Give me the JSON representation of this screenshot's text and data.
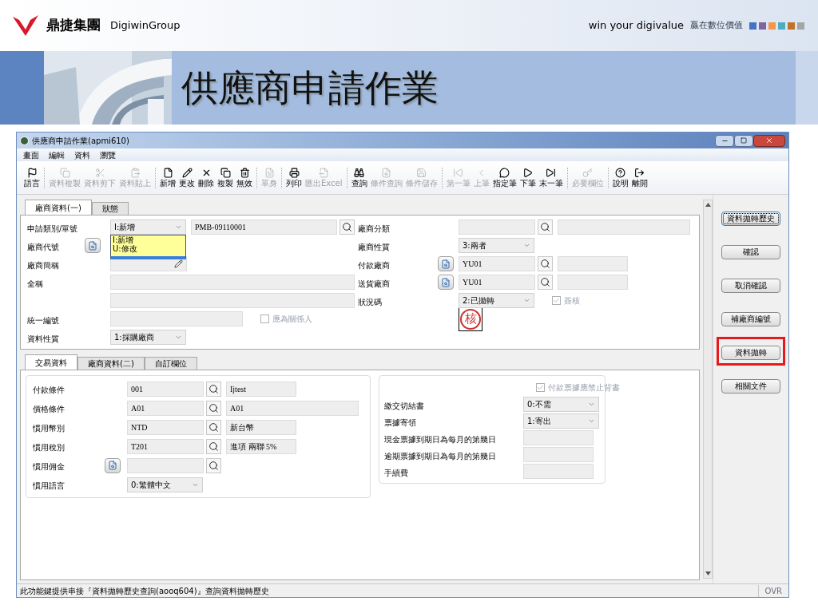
{
  "slide": {
    "brand": "鼎捷集團",
    "brand_en": "DigiwinGroup",
    "slogan": "win your digivalue",
    "slogan_zh": "贏在數位價值",
    "title": "供應商申請作業"
  },
  "window": {
    "title": "供應商申請作業(apmi610)",
    "menu": [
      "畫面",
      "編輯",
      "資料",
      "瀏覽"
    ],
    "toolbar": [
      [
        {
          "label": "語言",
          "disabled": false
        }
      ],
      [
        {
          "label": "資料複製",
          "disabled": true
        },
        {
          "label": "資料剪下",
          "disabled": true
        },
        {
          "label": "資料貼上",
          "disabled": true
        }
      ],
      [
        {
          "label": "新增",
          "disabled": false
        },
        {
          "label": "更改",
          "disabled": false
        },
        {
          "label": "刪除",
          "disabled": false
        },
        {
          "label": "複製",
          "disabled": false
        },
        {
          "label": "無效",
          "disabled": false
        }
      ],
      [
        {
          "label": "單身",
          "disabled": true
        }
      ],
      [
        {
          "label": "列印",
          "disabled": false
        },
        {
          "label": "匯出Excel",
          "disabled": true
        }
      ],
      [
        {
          "label": "查詢",
          "disabled": false
        },
        {
          "label": "條件查詢",
          "disabled": true
        },
        {
          "label": "條件儲存",
          "disabled": true
        }
      ],
      [
        {
          "label": "第一筆",
          "disabled": true
        },
        {
          "label": "上筆",
          "disabled": true
        },
        {
          "label": "指定筆",
          "disabled": false
        },
        {
          "label": "下筆",
          "disabled": false
        },
        {
          "label": "末一筆",
          "disabled": false
        }
      ],
      [
        {
          "label": "必要欄位",
          "disabled": true
        }
      ],
      [
        {
          "label": "說明",
          "disabled": false
        },
        {
          "label": "離開",
          "disabled": false
        }
      ]
    ],
    "tabs": [
      {
        "label": "廠商資料(一)",
        "selected": true
      },
      {
        "label": "狀態",
        "selected": false
      }
    ],
    "form_left": [
      {
        "label": "申請類別/單號",
        "controls": [
          {
            "kind": "select",
            "value": "I:新增",
            "open": true,
            "options": [
              "I:新增",
              "U:修改"
            ]
          },
          {
            "kind": "long_lookup",
            "value": "PMB-09110001"
          }
        ]
      },
      {
        "label": "廠商代號",
        "controls": [
          {
            "kind": "browse"
          }
        ]
      },
      {
        "label": "廠商簡稱",
        "controls": [
          {
            "kind": "edit"
          }
        ]
      },
      {
        "label": "全稱",
        "controls": [
          {
            "kind": "wide_field"
          }
        ]
      },
      {
        "controls": [
          {
            "kind": "wide_field"
          }
        ]
      },
      {
        "label": "統一編號",
        "controls": [
          {
            "kind": "long_field"
          },
          {
            "kind": "check",
            "label": "應為關係人",
            "checked": false,
            "disabled": true
          }
        ]
      },
      {
        "label": "資料性質",
        "controls": [
          {
            "kind": "select",
            "value": "1:採購廠商",
            "open": false
          }
        ]
      }
    ],
    "form_right": [
      {
        "label": "廠商分類",
        "controls": [
          {
            "kind": "lookup"
          },
          {
            "kind": "long_field"
          }
        ]
      },
      {
        "label": "廠商性質",
        "controls": [
          {
            "kind": "select",
            "value": "3:兩者",
            "open": false
          }
        ]
      },
      {
        "label": "付款廠商",
        "controls": [
          {
            "kind": "browse"
          },
          {
            "kind": "lookup",
            "value": "YU01"
          },
          {
            "kind": "field"
          }
        ]
      },
      {
        "label": "送貨廠商",
        "controls": [
          {
            "kind": "browse"
          },
          {
            "kind": "lookup",
            "value": "YU01"
          },
          {
            "kind": "field"
          }
        ]
      },
      {
        "label": "狀況碼",
        "controls": [
          {
            "kind": "select",
            "value": "2:已拋轉",
            "open": false
          },
          {
            "kind": "check",
            "label": "簽核",
            "checked": true,
            "disabled": true
          }
        ]
      },
      {
        "controls": [
          {
            "kind": "stamp",
            "value": "核"
          }
        ]
      }
    ],
    "side_buttons": [
      {
        "label": "資料拋轉歷史",
        "focused": true,
        "highlighted": false
      },
      {
        "label": "確認",
        "focused": false,
        "highlighted": false
      },
      {
        "label": "取消確認",
        "focused": false,
        "highlighted": false
      },
      {
        "label": "補廠商編號",
        "focused": false,
        "highlighted": false
      },
      {
        "label": "資料拋轉",
        "focused": false,
        "highlighted": true
      },
      {
        "label": "相關文件",
        "focused": false,
        "highlighted": false
      }
    ],
    "detail_tabs": [
      {
        "label": "交易資料",
        "selected": true
      },
      {
        "label": "廠商資料(二)",
        "selected": false
      },
      {
        "label": "自訂欄位",
        "selected": false
      }
    ],
    "detail_left": [
      {
        "label": "付款條件",
        "controls": [
          {
            "kind": "lookup",
            "value": "001"
          },
          {
            "kind": "field",
            "value": "Ijtest"
          }
        ]
      },
      {
        "label": "價格條件",
        "controls": [
          {
            "kind": "lookup",
            "value": "A01"
          },
          {
            "kind": "long_field",
            "value": "A01"
          }
        ]
      },
      {
        "label": "慣用幣別",
        "controls": [
          {
            "kind": "lookup",
            "value": "NTD"
          },
          {
            "kind": "field",
            "value": "新台幣"
          }
        ]
      },
      {
        "label": "慣用稅別",
        "controls": [
          {
            "kind": "lookup",
            "value": "T201"
          },
          {
            "kind": "field",
            "value": "進項 兩聯 5%"
          }
        ]
      },
      {
        "label": "慣用佣金",
        "controls": [
          {
            "kind": "browse"
          },
          {
            "kind": "lookup"
          }
        ]
      },
      {
        "label": "慣用語言",
        "controls": [
          {
            "kind": "select",
            "value": "0:繁體中文",
            "open": false
          }
        ]
      }
    ],
    "detail_right": [
      {
        "controls": [
          {
            "kind": "check",
            "label": "付款票據應禁止背書",
            "checked": true,
            "disabled": true
          }
        ]
      },
      {
        "label": "繳交切結書",
        "controls": [
          {
            "kind": "select",
            "value": "0:不需",
            "open": false
          }
        ]
      },
      {
        "label": "票據寄領",
        "controls": [
          {
            "kind": "select",
            "value": "1:寄出",
            "open": false
          }
        ]
      },
      {
        "label": "現金票據到期日為每月的第幾日",
        "controls": [
          {
            "kind": "field"
          }
        ]
      },
      {
        "label": "逾期票據到期日為每月的第幾日",
        "controls": [
          {
            "kind": "field"
          }
        ]
      },
      {
        "label": "手續費",
        "controls": [
          {
            "kind": "field"
          }
        ]
      }
    ],
    "status_bar": {
      "message": "此功能鍵提供串接『資料拋轉歷史查詢(aooq604)』查詢資料拋轉歷史",
      "mode": "OVR"
    }
  }
}
